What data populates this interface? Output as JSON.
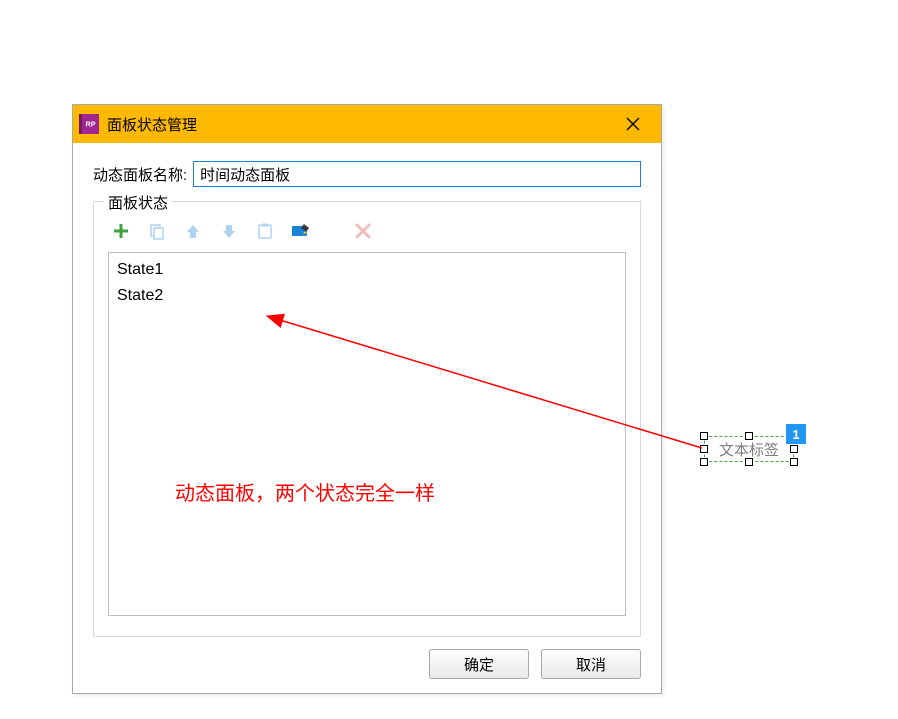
{
  "dialog": {
    "app_icon_text": "RP",
    "title": "面板状态管理",
    "name_label": "动态面板名称:",
    "name_value": "时间动态面板",
    "states_legend": "面板状态",
    "toolbar": {
      "add": "add-icon",
      "duplicate": "duplicate-icon",
      "move_up": "arrow-up-icon",
      "move_down": "arrow-down-icon",
      "paste": "paste-icon",
      "edit": "edit-icon",
      "delete": "delete-icon"
    },
    "states": [
      "State1",
      "State2"
    ],
    "ok_label": "确定",
    "cancel_label": "取消"
  },
  "annotation": "动态面板，两个状态完全一样",
  "canvas": {
    "widget_text": "文本标签",
    "badge": "1"
  }
}
